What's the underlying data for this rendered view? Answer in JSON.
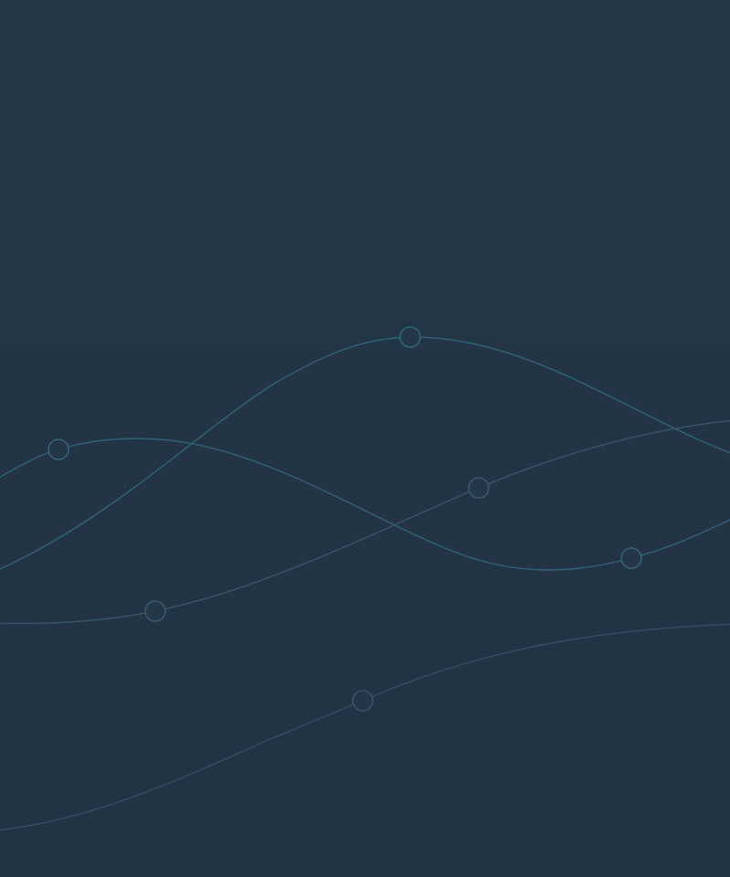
{
  "background": {
    "color": "#233545"
  },
  "decoration": {
    "curve_colors": {
      "teal": "#2f6478",
      "teal_dim": "#2c5a6e",
      "slate": "#3a556c",
      "slate_dim": "#354d66"
    },
    "node_stroke": "#30647a"
  }
}
